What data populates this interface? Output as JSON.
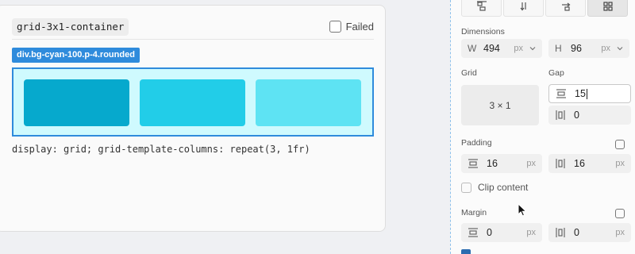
{
  "test_card": {
    "title": "grid-3x1-container",
    "failed_label": "Failed",
    "class_badge": "div.bg-cyan-100.p-4.rounded",
    "css_text": "display: grid; grid-template-columns: repeat(3, 1fr)"
  },
  "toolbar": {
    "tools": [
      "align-top-icon",
      "arrow-down-icon",
      "arrow-right-icon",
      "grid-icon"
    ],
    "active": "grid-icon"
  },
  "dimensions": {
    "label": "Dimensions",
    "width_prefix": "W",
    "width_value": "494",
    "width_unit": "px",
    "height_prefix": "H",
    "height_value": "96",
    "height_unit": "px"
  },
  "grid": {
    "label": "Grid",
    "value": "3 × 1"
  },
  "gap": {
    "label": "Gap",
    "row_value": "15",
    "column_value": "0"
  },
  "padding": {
    "label": "Padding",
    "vertical_value": "16",
    "vertical_unit": "px",
    "horizontal_value": "16",
    "horizontal_unit": "px"
  },
  "clip_content": {
    "label": "Clip content",
    "checked": false
  },
  "margin": {
    "label": "Margin",
    "vertical_value": "0",
    "vertical_unit": "px",
    "horizontal_value": "0",
    "horizontal_unit": "px"
  },
  "colors": {
    "accent": "#2f8bdc",
    "cell_1": "#06a9cd",
    "cell_2": "#22cde8",
    "cell_3": "#5ee3f3",
    "preview_bg": "#cffafe"
  }
}
